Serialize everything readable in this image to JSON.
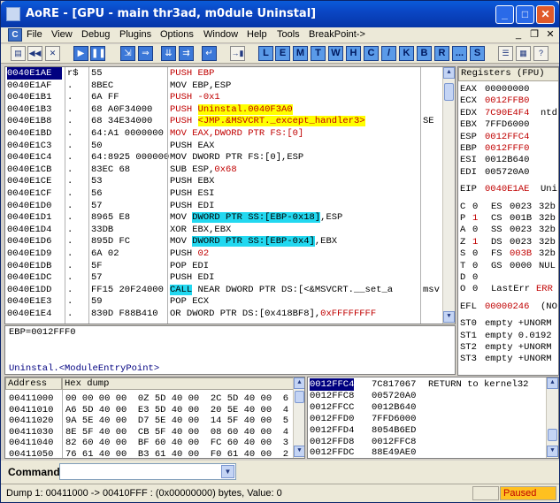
{
  "window": {
    "title": "AoRE - [GPU - main thr3ad, m0dule Uninstal]"
  },
  "menu": {
    "items": [
      "File",
      "View",
      "Debug",
      "Plugins",
      "Options",
      "Window",
      "Help",
      "Tools",
      "BreakPoint->"
    ]
  },
  "toolbar": {
    "letters": [
      "L",
      "E",
      "M",
      "T",
      "W",
      "H",
      "C",
      "/",
      "K",
      "B",
      "R",
      "...",
      "S"
    ]
  },
  "disasm": {
    "rows": [
      {
        "addr": "0040E1AE",
        "mark": "r$",
        "hex": "55",
        "instr": "PUSH EBP",
        "extra": "",
        "selected": true
      },
      {
        "addr": "0040E1AF",
        "mark": ".",
        "hex": "8BEC",
        "instr": "MOV EBP,ESP",
        "extra": ""
      },
      {
        "addr": "0040E1B1",
        "mark": ".",
        "hex": "6A FF",
        "instr": "PUSH -0x1",
        "extra": ""
      },
      {
        "addr": "0040E1B3",
        "mark": ".",
        "hex": "68 A0F34000",
        "instr": "PUSH Uninstal.0040F3A0",
        "extra": ""
      },
      {
        "addr": "0040E1B8",
        "mark": ".",
        "hex": "68 34E34000",
        "instr": "PUSH <JMP.&MSVCRT._except_handler3>",
        "extra": "SE"
      },
      {
        "addr": "0040E1BD",
        "mark": ".",
        "hex": "64:A1 0000000",
        "instr": "MOV EAX,DWORD PTR FS:[0]",
        "extra": ""
      },
      {
        "addr": "0040E1C3",
        "mark": ".",
        "hex": "50",
        "instr": "PUSH EAX",
        "extra": ""
      },
      {
        "addr": "0040E1C4",
        "mark": ".",
        "hex": "64:8925 000000",
        "instr": "MOV DWORD PTR FS:[0],ESP",
        "extra": ""
      },
      {
        "addr": "0040E1CB",
        "mark": ".",
        "hex": "83EC 68",
        "instr": "SUB ESP,0x68",
        "extra": ""
      },
      {
        "addr": "0040E1CE",
        "mark": ".",
        "hex": "53",
        "instr": "PUSH EBX",
        "extra": ""
      },
      {
        "addr": "0040E1CF",
        "mark": ".",
        "hex": "56",
        "instr": "PUSH ESI",
        "extra": ""
      },
      {
        "addr": "0040E1D0",
        "mark": ".",
        "hex": "57",
        "instr": "PUSH EDI",
        "extra": ""
      },
      {
        "addr": "0040E1D1",
        "mark": ".",
        "hex": "8965 E8",
        "instr": "MOV DWORD PTR SS:[EBP-0x18],ESP",
        "extra": ""
      },
      {
        "addr": "0040E1D4",
        "mark": ".",
        "hex": "33DB",
        "instr": "XOR EBX,EBX",
        "extra": ""
      },
      {
        "addr": "0040E1D6",
        "mark": ".",
        "hex": "895D FC",
        "instr": "MOV DWORD PTR SS:[EBP-0x4],EBX",
        "extra": ""
      },
      {
        "addr": "0040E1D9",
        "mark": ".",
        "hex": "6A 02",
        "instr": "PUSH 02",
        "extra": ""
      },
      {
        "addr": "0040E1DB",
        "mark": ".",
        "hex": "5F",
        "instr": "POP EDI",
        "extra": ""
      },
      {
        "addr": "0040E1DC",
        "mark": ".",
        "hex": "57",
        "instr": "PUSH EDI",
        "extra": ""
      },
      {
        "addr": "0040E1DD",
        "mark": ".",
        "hex": "FF15 20F24000",
        "instr": "CALL NEAR DWORD PTR DS:[<&MSVCRT.__set_a",
        "extra": "msv"
      },
      {
        "addr": "0040E1E3",
        "mark": ".",
        "hex": "59",
        "instr": "POP ECX",
        "extra": ""
      },
      {
        "addr": "0040E1E4",
        "mark": ".",
        "hex": "830D F88B410",
        "instr": "OR DWORD PTR DS:[0x418BF8],0xFFFFFFFF",
        "extra": ""
      }
    ]
  },
  "info": {
    "line1": "EBP=0012FFF0",
    "line2": "Uninstal.<ModuleEntryPoint>"
  },
  "registers": {
    "header": "Registers (FPU)",
    "gp": [
      {
        "name": "EAX",
        "value": "00000000",
        "extra": ""
      },
      {
        "name": "ECX",
        "value": "0012FFB0",
        "extra": ""
      },
      {
        "name": "EDX",
        "value": "7C90E4F4",
        "extra": "ntd"
      },
      {
        "name": "EBX",
        "value": "7FFD6000",
        "extra": ""
      },
      {
        "name": "ESP",
        "value": "0012FFC4",
        "extra": ""
      },
      {
        "name": "EBP",
        "value": "0012FFF0",
        "extra": ""
      },
      {
        "name": "ESI",
        "value": "0012B640",
        "extra": ""
      },
      {
        "name": "EDI",
        "value": "005720A0",
        "extra": ""
      }
    ],
    "eip": {
      "name": "EIP",
      "value": "0040E1AE",
      "extra": "Uni"
    },
    "flags": [
      {
        "f": "C",
        "v": "0",
        "seg": "ES",
        "sv": "0023",
        "bits": "32b"
      },
      {
        "f": "P",
        "v": "1",
        "seg": "CS",
        "sv": "001B",
        "bits": "32b"
      },
      {
        "f": "A",
        "v": "0",
        "seg": "SS",
        "sv": "0023",
        "bits": "32b"
      },
      {
        "f": "Z",
        "v": "1",
        "seg": "DS",
        "sv": "0023",
        "bits": "32b"
      },
      {
        "f": "S",
        "v": "0",
        "seg": "FS",
        "sv": "003B",
        "bits": "32b"
      },
      {
        "f": "T",
        "v": "0",
        "seg": "GS",
        "sv": "0000",
        "bits": "NUL"
      },
      {
        "f": "D",
        "v": "0",
        "seg": "",
        "sv": "",
        "bits": ""
      },
      {
        "f": "O",
        "v": "0",
        "seg": "LastErr",
        "sv": "ERR",
        "bits": ""
      }
    ],
    "efl": {
      "name": "EFL",
      "value": "00000246",
      "extra": "(NO"
    },
    "fpu": [
      {
        "name": "ST0",
        "value": "empty +UNORM"
      },
      {
        "name": "ST1",
        "value": "empty 0.0192"
      },
      {
        "name": "ST2",
        "value": "empty +UNORM"
      },
      {
        "name": "ST3",
        "value": "empty +UNORM"
      }
    ]
  },
  "dump": {
    "headers": {
      "address": "Address",
      "hex": "Hex dump"
    },
    "rows": [
      {
        "addr": "00411000",
        "hex": "00 00 00 00  0Z 5D 40 00  2C 5D 40 00  6"
      },
      {
        "addr": "00411010",
        "hex": "A6 5D 40 00  E3 5D 40 00  20 5E 40 00  4"
      },
      {
        "addr": "00411020",
        "hex": "9A 5E 40 00  D7 5E 40 00  14 5F 40 00  5"
      },
      {
        "addr": "00411030",
        "hex": "8E 5F 40 00  CB 5F 40 00  08 60 40 00  4"
      },
      {
        "addr": "00411040",
        "hex": "82 60 40 00  BF 60 40 00  FC 60 40 00  3"
      },
      {
        "addr": "00411050",
        "hex": "76 61 40 00  B3 61 40 00  F0 61 40 00  2"
      }
    ]
  },
  "stack": {
    "rows": [
      {
        "addr": "0012FFC4",
        "value": "7C817067",
        "comment": "RETURN to kernel32",
        "selected": true
      },
      {
        "addr": "0012FFC8",
        "value": "005720A0",
        "comment": ""
      },
      {
        "addr": "0012FFCC",
        "value": "0012B640",
        "comment": ""
      },
      {
        "addr": "0012FFD0",
        "value": "7FFD6000",
        "comment": ""
      },
      {
        "addr": "0012FFD4",
        "value": "8054B6ED",
        "comment": ""
      },
      {
        "addr": "0012FFD8",
        "value": "0012FFC8",
        "comment": ""
      },
      {
        "addr": "0012FFDC",
        "value": "88E49AE0",
        "comment": ""
      }
    ]
  },
  "command": {
    "label": "Command",
    "value": ""
  },
  "status": {
    "text": "Dump 1: 00411000 -> 00410FFF : (0x00000000) bytes, Value: 0",
    "state": "Paused"
  },
  "colors": {
    "title_bg": "#0a46c4",
    "selected_row": "#000080",
    "yellow": "#ffff00",
    "cyan": "#22d8f0",
    "red": "#cc0000",
    "paused_bg": "#ffc020"
  }
}
